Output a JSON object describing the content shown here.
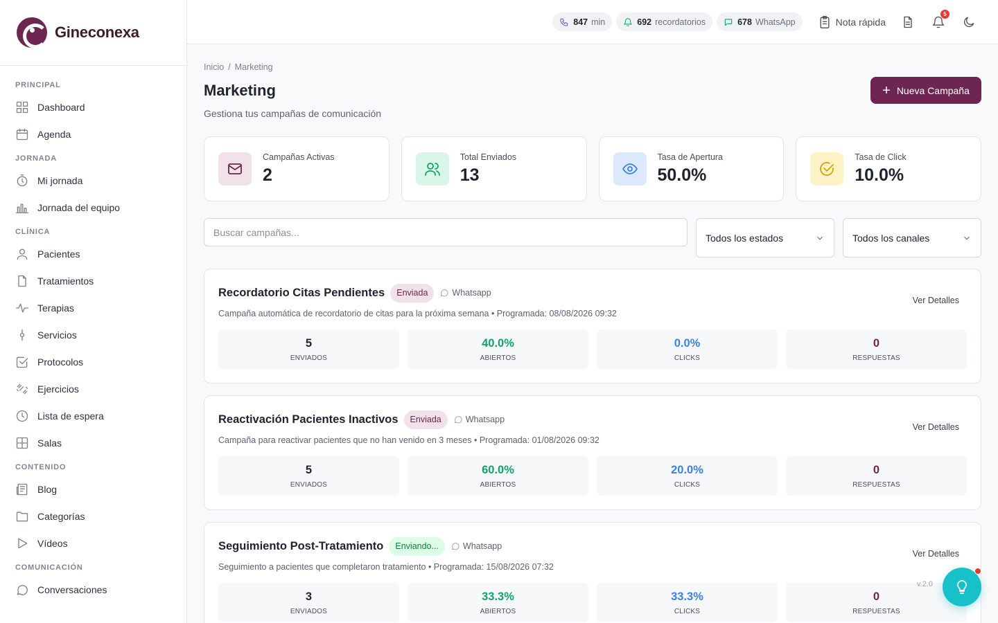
{
  "brand": {
    "name": "Gineconexa"
  },
  "sidebar": {
    "sections": [
      {
        "title": "PRINCIPAL",
        "items": [
          {
            "label": "Dashboard",
            "icon": "grid-icon"
          },
          {
            "label": "Agenda",
            "icon": "calendar-icon"
          }
        ]
      },
      {
        "title": "JORNADA",
        "items": [
          {
            "label": "Mi jornada",
            "icon": "timer-icon"
          },
          {
            "label": "Jornada del equipo",
            "icon": "bar-chart-icon"
          }
        ]
      },
      {
        "title": "CLÍNICA",
        "items": [
          {
            "label": "Pacientes",
            "icon": "user-icon"
          },
          {
            "label": "Tratamientos",
            "icon": "file-icon"
          },
          {
            "label": "Terapias",
            "icon": "activity-icon"
          },
          {
            "label": "Servicios",
            "icon": "pin-icon"
          },
          {
            "label": "Protocolos",
            "icon": "checkbox-icon"
          },
          {
            "label": "Ejercicios",
            "icon": "dumbbell-icon"
          },
          {
            "label": "Lista de espera",
            "icon": "clock-icon"
          },
          {
            "label": "Salas",
            "icon": "layout-icon"
          }
        ]
      },
      {
        "title": "CONTENIDO",
        "items": [
          {
            "label": "Blog",
            "icon": "newspaper-icon"
          },
          {
            "label": "Categorías",
            "icon": "folder-icon"
          },
          {
            "label": "Vídeos",
            "icon": "play-icon"
          }
        ]
      },
      {
        "title": "COMUNICACIÓN",
        "items": [
          {
            "label": "Conversaciones",
            "icon": "chat-icon"
          }
        ]
      }
    ]
  },
  "topbar": {
    "minutes": {
      "value": "847",
      "unit": "min"
    },
    "reminders": {
      "value": "692",
      "unit": "recordatorios"
    },
    "whatsapp": {
      "value": "678",
      "unit": "WhatsApp"
    },
    "quick_note": "Nota rápida",
    "notifications_count": "5"
  },
  "page": {
    "breadcrumb": [
      "Inicio",
      "/",
      "Marketing"
    ],
    "title": "Marketing",
    "subtitle": "Gestiona tus campañas de comunicación",
    "new_button": "Nueva Campaña"
  },
  "stats": [
    {
      "label": "Campañas Activas",
      "value": "2",
      "icon": "mail-icon",
      "bg": "#f1e1e8",
      "color": "#6d2651"
    },
    {
      "label": "Total Enviados",
      "value": "13",
      "icon": "users-icon",
      "bg": "#d9f7e8",
      "color": "#10a36a"
    },
    {
      "label": "Tasa de Apertura",
      "value": "50.0%",
      "icon": "eye-icon",
      "bg": "#dce8fb",
      "color": "#3a82e0"
    },
    {
      "label": "Tasa de Click",
      "value": "10.0%",
      "icon": "check-circle-icon",
      "bg": "#fdf3c7",
      "color": "#d9a10b"
    }
  ],
  "filters": {
    "search_placeholder": "Buscar campañas...",
    "status": "Todos los estados",
    "channel": "Todos los canales"
  },
  "campaigns": [
    {
      "title": "Recordatorio Citas Pendientes",
      "status": "Enviada",
      "channel": "Whatsapp",
      "description": "Campaña automática de recordatorio de citas para la próxima semana • Programada: 08/08/2026 09:32",
      "details": "Ver Detalles",
      "sent": "5",
      "opened": "40.0%",
      "clicks": "0.0%",
      "responses": "0"
    },
    {
      "title": "Reactivación Pacientes Inactivos",
      "status": "Enviada",
      "channel": "Whatsapp",
      "description": "Campaña para reactivar pacientes que no han venido en 3 meses • Programada: 01/08/2026 09:32",
      "details": "Ver Detalles",
      "sent": "5",
      "opened": "60.0%",
      "clicks": "20.0%",
      "responses": "0"
    },
    {
      "title": "Seguimiento Post-Tratamiento",
      "status": "Enviando...",
      "channel": "Whatsapp",
      "description": "Seguimiento a pacientes que completaron tratamiento • Programada: 15/08/2026 07:32",
      "details": "Ver Detalles",
      "sent": "3",
      "opened": "33.3%",
      "clicks": "33.3%",
      "responses": "0"
    }
  ],
  "metric_labels": {
    "sent": "ENVIADOS",
    "opened": "ABIERTOS",
    "clicks": "CLICKS",
    "responses": "RESPUESTAS"
  },
  "version": "v.2.0"
}
